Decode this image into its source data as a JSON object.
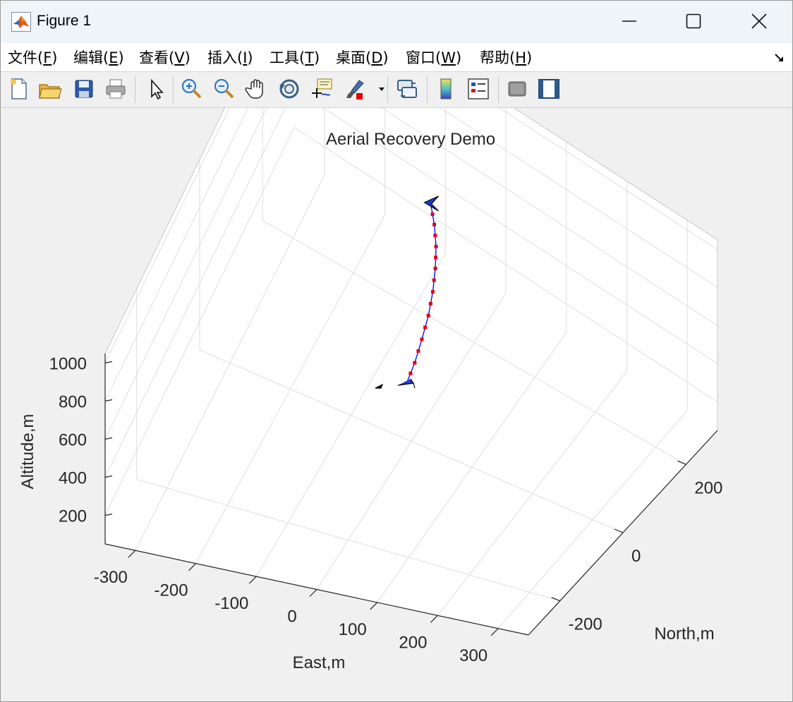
{
  "window": {
    "title": "Figure 1",
    "controls": [
      "minimize",
      "maximize",
      "close"
    ]
  },
  "menu": [
    {
      "label": "文件",
      "mnemonic": "F",
      "suffix": ")"
    },
    {
      "label": "编辑",
      "mnemonic": "E",
      "suffix": ")"
    },
    {
      "label": "查看",
      "mnemonic": "V",
      "suffix": ")"
    },
    {
      "label": "插入",
      "mnemonic": "I",
      "suffix": ")"
    },
    {
      "label": "工具",
      "mnemonic": "T",
      "suffix": ")"
    },
    {
      "label": "桌面",
      "mnemonic": "D",
      "suffix": ")"
    },
    {
      "label": "窗口",
      "mnemonic": "W",
      "suffix": ")"
    },
    {
      "label": "帮助",
      "mnemonic": "H",
      "suffix": ")"
    }
  ],
  "toolbar": [
    "new-figure-icon",
    "open-file-icon",
    "save-icon",
    "print-icon",
    "edit-plot-arrow-icon",
    "zoom-in-icon",
    "zoom-out-icon",
    "pan-hand-icon",
    "rotate-3d-icon",
    "data-cursor-icon",
    "brush-icon",
    "brush-dropdown-icon",
    "link-plot-icon",
    "colorbar-icon",
    "legend-icon",
    "hide-plot-tools-icon",
    "show-plot-tools-icon"
  ],
  "chart_data": {
    "type": "line3d",
    "title": "Aerial Recovery Demo",
    "xlabel": "East,m",
    "ylabel": "North,m",
    "zlabel": "Altitude,m",
    "xticks": [
      "-300",
      "-200",
      "-100",
      "0",
      "100",
      "200",
      "300"
    ],
    "yticks": [
      "-200",
      "0",
      "200"
    ],
    "zticks": [
      "200",
      "400",
      "600",
      "800",
      "1000"
    ],
    "xlim": [
      -350,
      350
    ],
    "ylim": [
      -300,
      300
    ],
    "zlim": [
      50,
      1050
    ],
    "grid": true,
    "series": [
      {
        "color": "#0000ff",
        "marker_color": "#e0001a",
        "points": [
          [
            -20,
            100,
            1005
          ],
          [
            -12,
            96,
            920
          ],
          [
            -6,
            90,
            830
          ],
          [
            -3,
            82,
            740
          ],
          [
            -2,
            72,
            645
          ],
          [
            -3,
            60,
            550
          ],
          [
            -6,
            45,
            460
          ],
          [
            -10,
            30,
            370
          ],
          [
            -16,
            15,
            290
          ]
        ]
      }
    ],
    "annotations": [
      "aircraft-marker-top",
      "aircraft-marker-bottom",
      "ground-shadow-marker"
    ]
  }
}
